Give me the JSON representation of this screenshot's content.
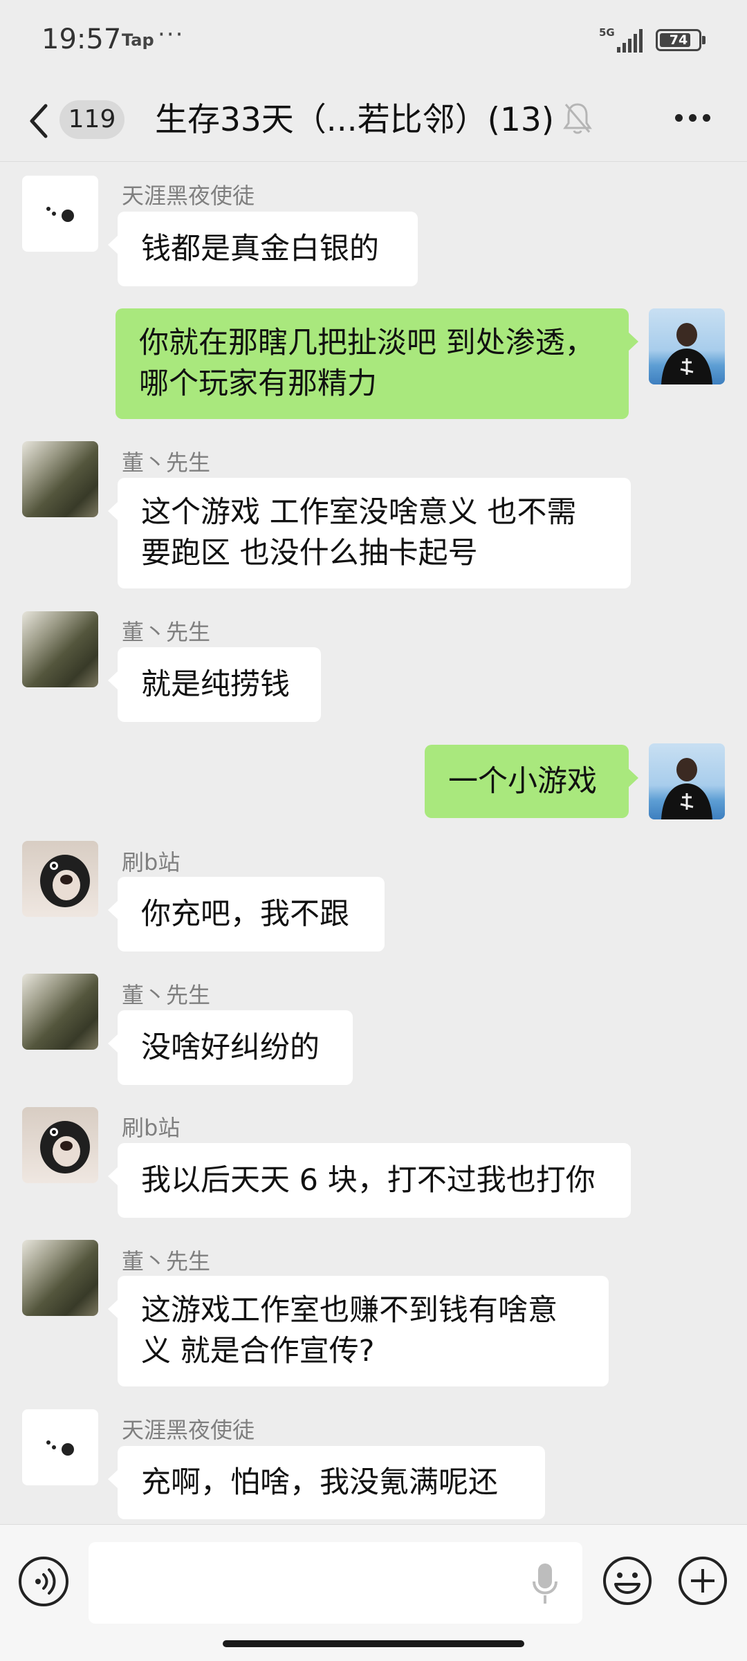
{
  "status_bar": {
    "time": "19:57",
    "app_tag": "Tap",
    "more": "···",
    "network": "5G",
    "battery": "74"
  },
  "header": {
    "unread_count": "119",
    "title": "生存33天（...若比邻）(13)",
    "icons": [
      "back-arrow-icon",
      "muted-bell-icon",
      "more-icon"
    ]
  },
  "messages": [
    {
      "sender": "天涯黑夜使徒",
      "direction": "in",
      "avatar": "dots-avatar",
      "lines": [
        "钱都是真金白银的"
      ]
    },
    {
      "sender": "",
      "direction": "out",
      "avatar": "self-avatar",
      "lines": [
        "你就在那瞎几把扯淡吧  到处渗透，",
        "哪个玩家有那精力"
      ]
    },
    {
      "sender": "董丶先生",
      "direction": "in",
      "avatar": "landscape-avatar",
      "lines": [
        "这个游戏 工作室没啥意义 也不需",
        "要跑区 也没什么抽卡起号"
      ]
    },
    {
      "sender": "董丶先生",
      "direction": "in",
      "avatar": "landscape-avatar",
      "lines": [
        "就是纯捞钱"
      ]
    },
    {
      "sender": "",
      "direction": "out",
      "avatar": "self-avatar",
      "lines": [
        "一个小游戏"
      ]
    },
    {
      "sender": "刷b站",
      "direction": "in",
      "avatar": "dog-avatar",
      "lines": [
        "你充吧，我不跟"
      ]
    },
    {
      "sender": "董丶先生",
      "direction": "in",
      "avatar": "landscape-avatar",
      "lines": [
        "没啥好纠纷的"
      ]
    },
    {
      "sender": "刷b站",
      "direction": "in",
      "avatar": "dog-avatar",
      "lines": [
        "我以后天天 6 块，打不过我也打你"
      ]
    },
    {
      "sender": "董丶先生",
      "direction": "in",
      "avatar": "landscape-avatar",
      "lines": [
        "这游戏工作室也赚不到钱有啥意",
        "义 就是合作宣传?"
      ]
    },
    {
      "sender": "天涯黑夜使徒",
      "direction": "in",
      "avatar": "dots-avatar",
      "lines": [
        "充啊，怕啥，我没氪满呢还"
      ]
    }
  ],
  "input_bar": {
    "text_value": "",
    "icons": [
      "voice-mode-icon",
      "microphone-icon",
      "emoji-icon",
      "plus-icon"
    ]
  }
}
